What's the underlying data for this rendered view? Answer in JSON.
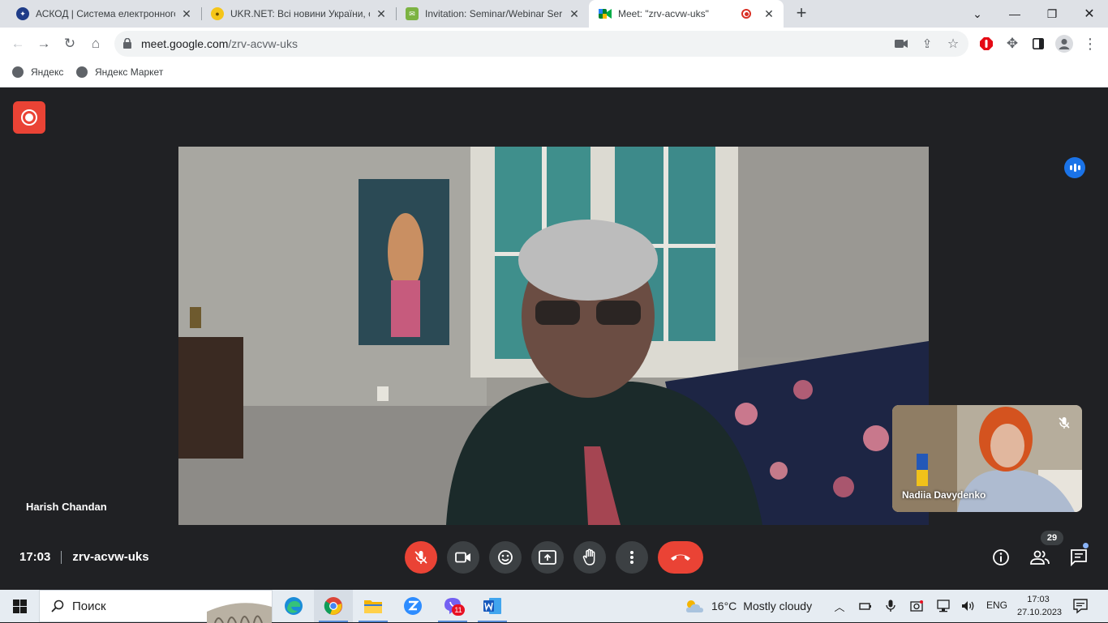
{
  "browser": {
    "tabs": [
      {
        "label": "АСКОД | Система електронного",
        "favicon": "askod-icon",
        "active": false
      },
      {
        "label": "UKR.NET: Всі новини України, о",
        "favicon": "ukrnet-icon",
        "active": false
      },
      {
        "label": "Invitation: Seminar/Webinar Ser",
        "favicon": "mail-icon",
        "active": false
      },
      {
        "label": "Meet: \"zrv-acvw-uks\"",
        "favicon": "meet-icon",
        "active": true
      }
    ],
    "url_host": "meet.google.com",
    "url_path": "/zrv-acvw-uks",
    "bookmarks": [
      "Яндекс",
      "Яндекс Маркет"
    ]
  },
  "meet": {
    "main_participant": "Harish Chandan",
    "self_participant": "Nadiia Davydenko",
    "time": "17:03",
    "meeting_code": "zrv-acvw-uks",
    "people_count": "29",
    "colors": {
      "background": "#202124",
      "control": "#3c4043",
      "danger": "#ea4335",
      "accent": "#1a73e8"
    }
  },
  "taskbar": {
    "search_placeholder": "Поиск",
    "weather_temp": "16°C",
    "weather_text": "Mostly cloudy",
    "language": "ENG",
    "clock_time": "17:03",
    "clock_date": "27.10.2023",
    "viber_badge": "11"
  }
}
